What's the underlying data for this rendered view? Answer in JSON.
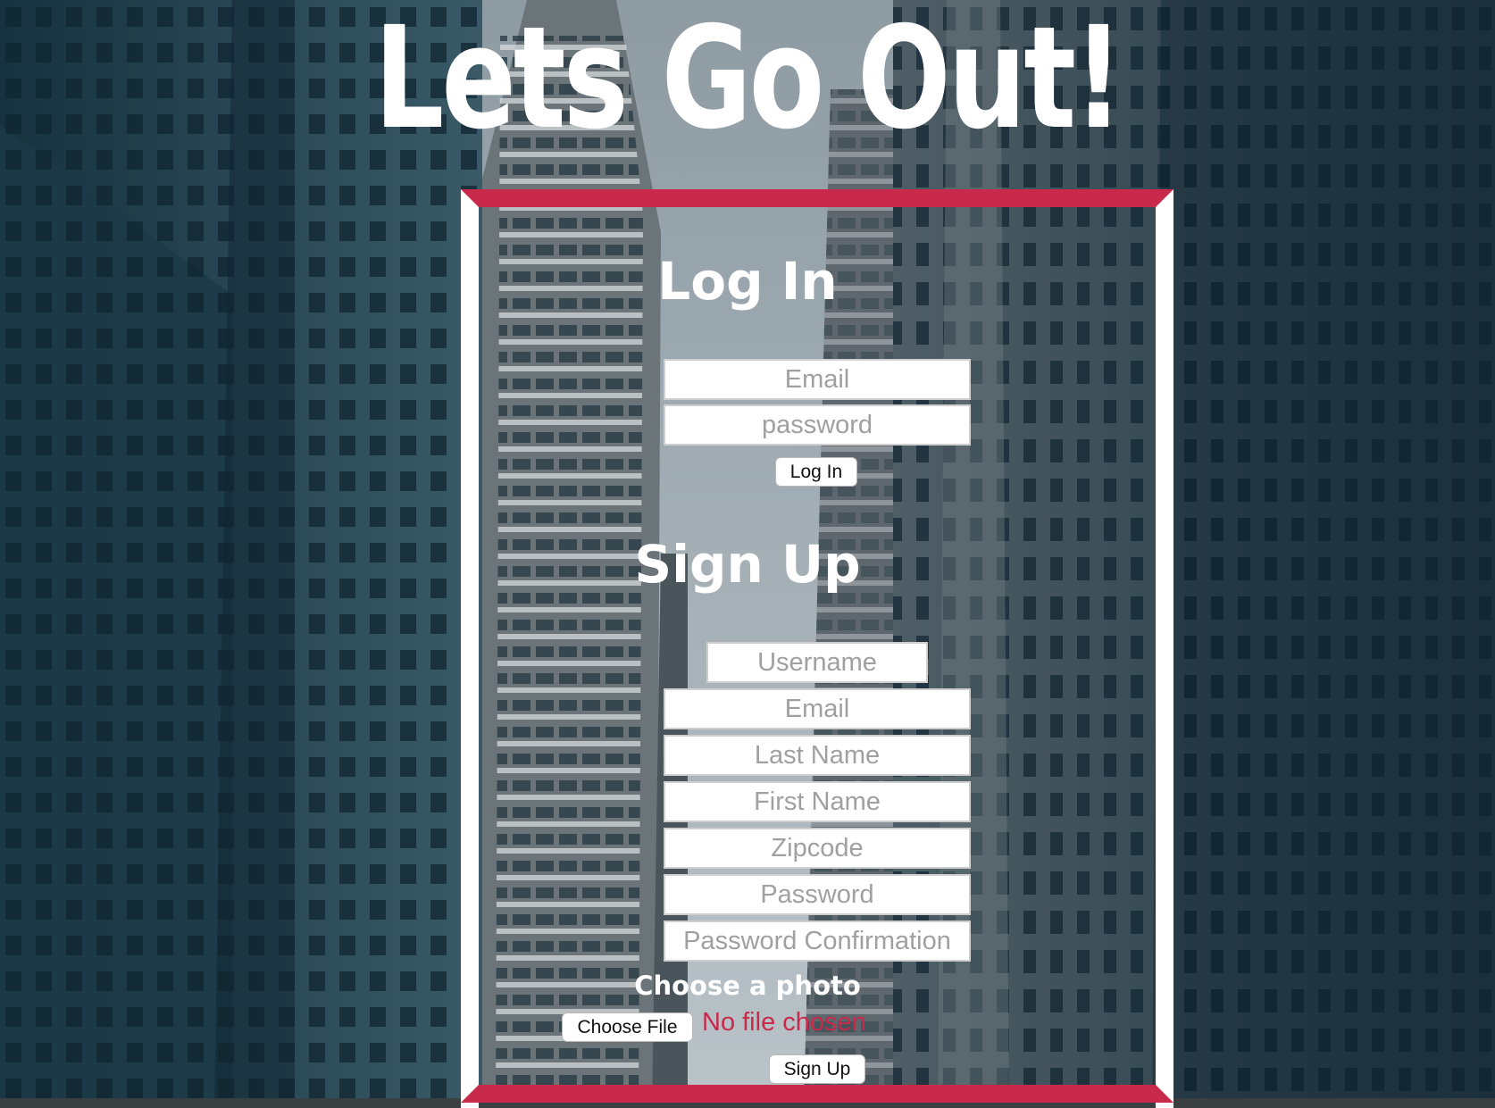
{
  "app": {
    "title": "Lets Go Out!"
  },
  "login": {
    "heading": "Log In",
    "email_placeholder": "Email",
    "password_placeholder": "password",
    "submit_label": "Log In"
  },
  "signup": {
    "heading": "Sign Up",
    "username_placeholder": "Username",
    "email_placeholder": "Email",
    "last_name_placeholder": "Last Name",
    "first_name_placeholder": "First Name",
    "zipcode_placeholder": "Zipcode",
    "password_placeholder": "Password",
    "password_confirmation_placeholder": "Password Confirmation",
    "photo_label": "Choose a photo",
    "choose_file_label": "Choose File",
    "file_status": "No file chosen",
    "submit_label": "Sign Up"
  },
  "colors": {
    "accent": "#c9294b",
    "frame": "#ffffff",
    "title_text": "#ffffff",
    "placeholder_text": "#a0a0a0",
    "background_tone": "#2c4a58"
  }
}
